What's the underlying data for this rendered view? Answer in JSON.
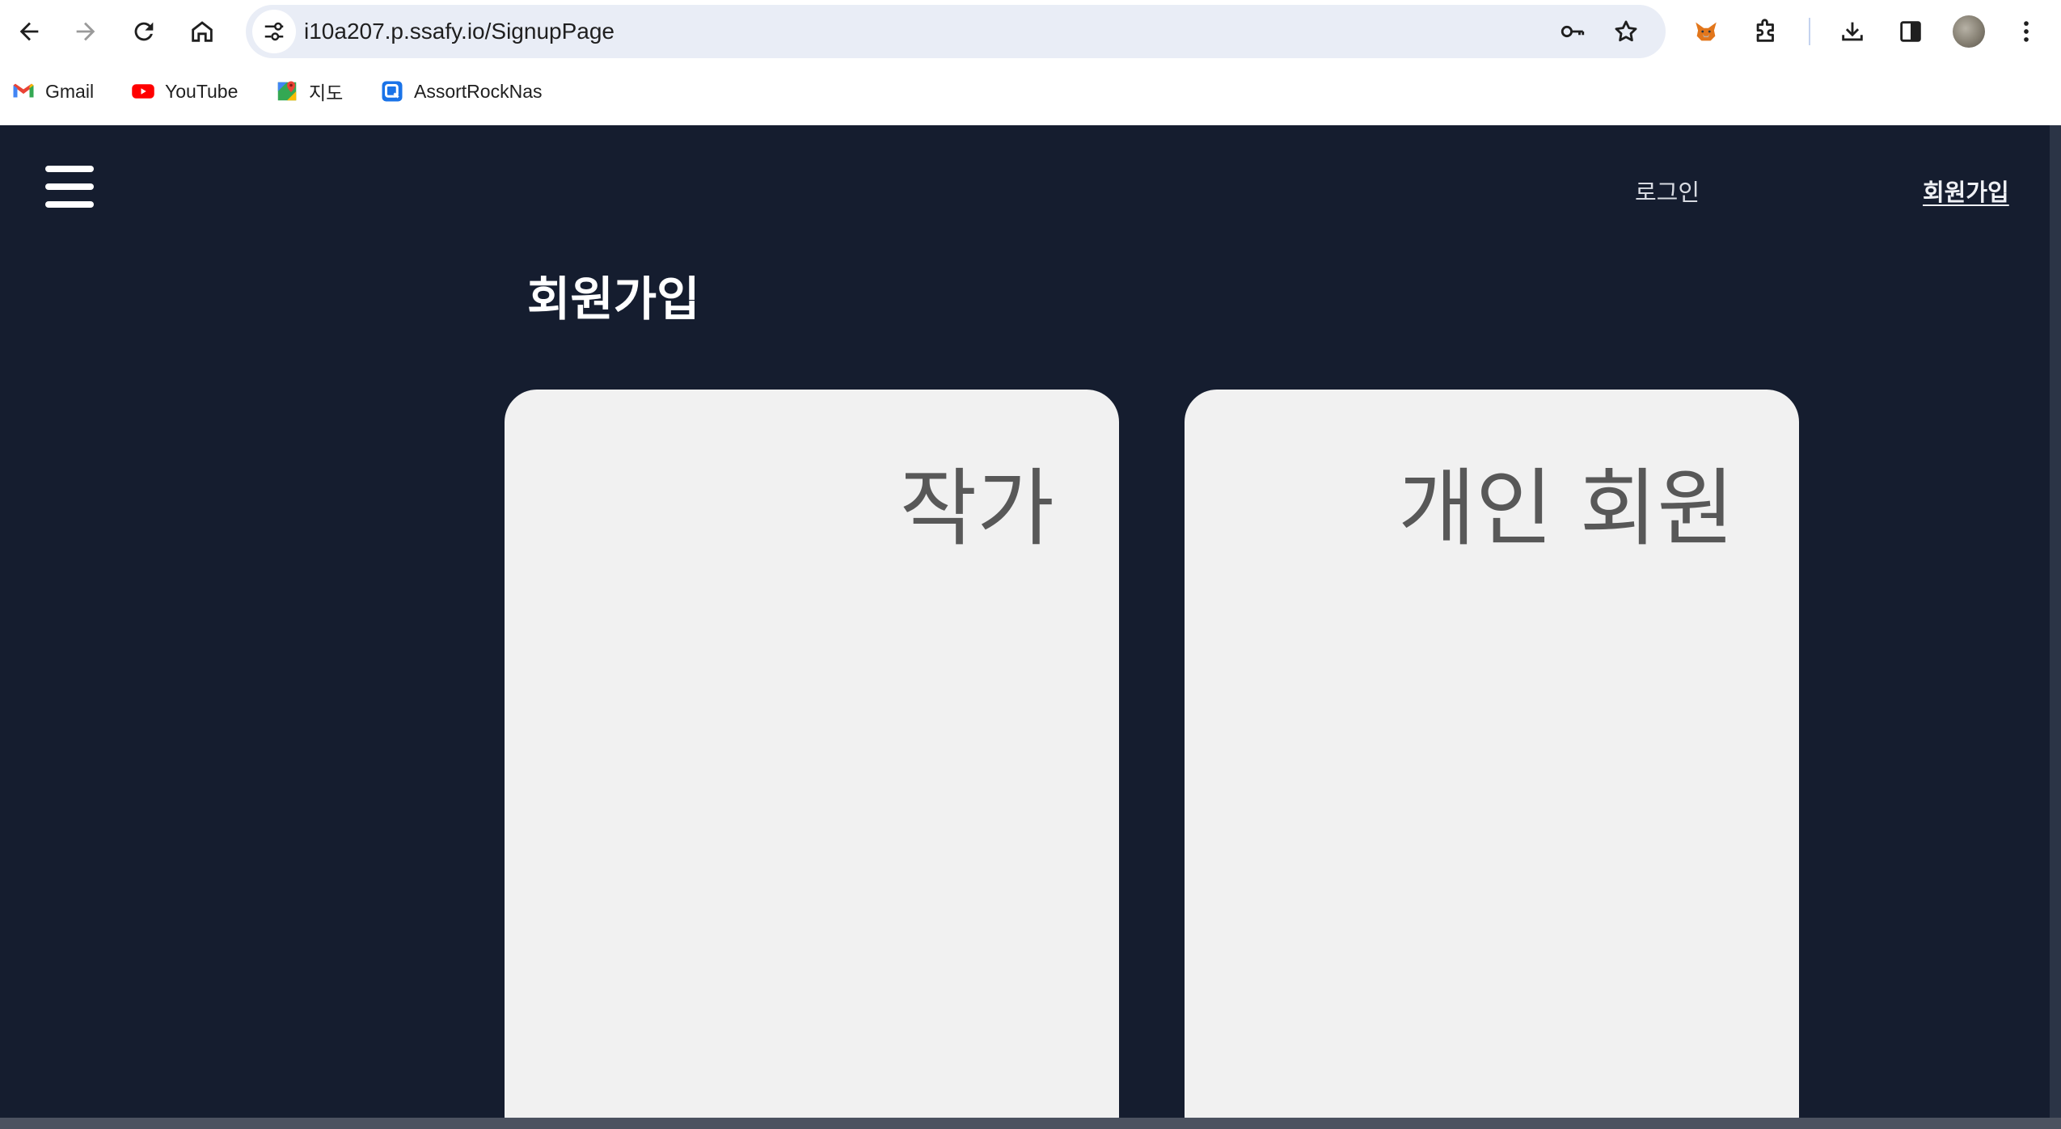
{
  "browser": {
    "url": "i10a207.p.ssafy.io/SignupPage",
    "bookmarks": [
      {
        "label": "Gmail",
        "icon": "gmail-icon"
      },
      {
        "label": "YouTube",
        "icon": "youtube-icon"
      },
      {
        "label": "지도",
        "icon": "maps-icon"
      },
      {
        "label": "AssortRockNas",
        "icon": "assortrock-icon"
      }
    ]
  },
  "header": {
    "menu_icon": "hamburger-menu-icon",
    "login_label": "로그인",
    "signup_label": "회원가입"
  },
  "main": {
    "title": "회원가입",
    "cards": [
      {
        "label": "작가"
      },
      {
        "label": "개인 회원"
      }
    ]
  },
  "colors": {
    "background": "#151d2f",
    "card": "#f1f1f1",
    "card_text": "#585858",
    "nav_text": "#d8dbe2"
  }
}
